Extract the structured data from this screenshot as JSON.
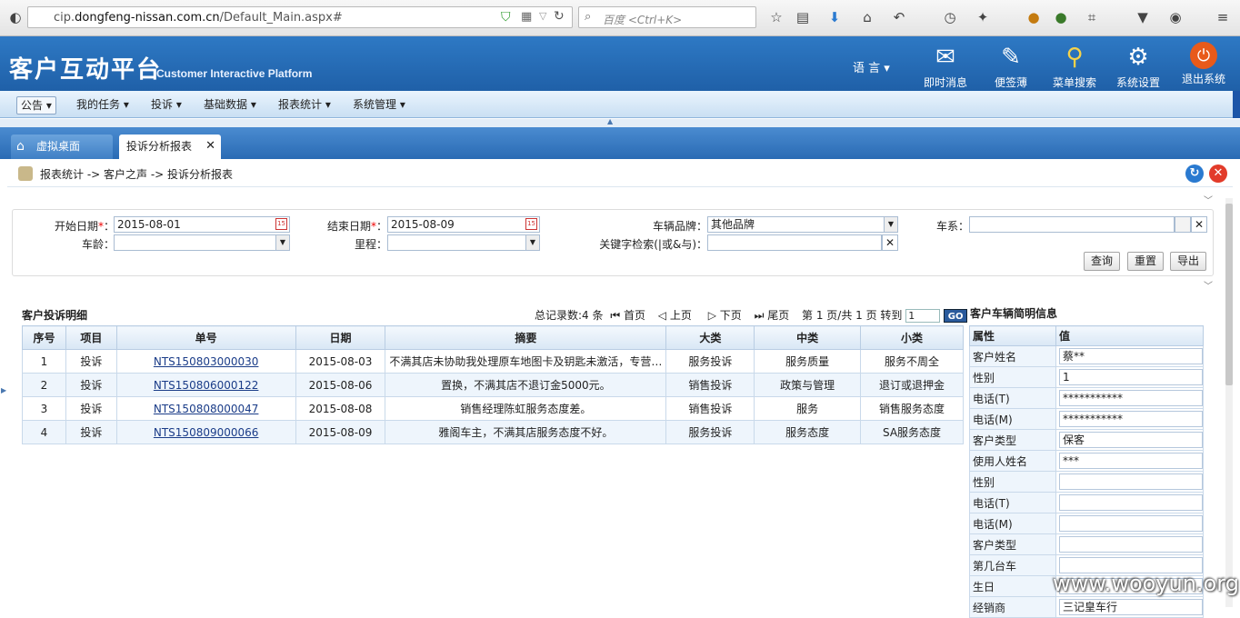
{
  "browser": {
    "url_prefix": "cip.",
    "url_domain": "dongfeng-nissan.com.cn",
    "url_path": "/Default_Main.aspx#",
    "search_placeholder": "百度 <Ctrl+K>"
  },
  "header": {
    "title": "客户互动平台",
    "subtitle": "Customer Interactive Platform",
    "language": "语 言",
    "tools": [
      "即时消息",
      "便签薄",
      "菜单搜索",
      "系统设置",
      "退出系统"
    ]
  },
  "menu": [
    "公告",
    "我的任务",
    "投诉",
    "基础数据",
    "报表统计",
    "系统管理"
  ],
  "tabs": [
    "虚拟桌面",
    "投诉分析报表"
  ],
  "breadcrumb": "报表统计 -> 客户之声 -> 投诉分析报表",
  "filter": {
    "start_label": "开始日期",
    "start_value": "2015-08-01",
    "end_label": "结束日期",
    "end_value": "2015-08-09",
    "brand_label": "车辆品牌：",
    "brand_value": "其他品牌",
    "series_label": "车系：",
    "age_label": "车龄：",
    "mileage_label": "里程：",
    "keyword_label": "关键字检索(|或&与)：",
    "query": "查询",
    "reset": "重置",
    "export": "导出"
  },
  "complaints": {
    "title": "客户投诉明细",
    "pager": {
      "total": "总记录数:4 条",
      "first": "首页",
      "prev": "上页",
      "next": "下页",
      "last": "尾页",
      "page_info": "第 1 页/共 1 页 转到",
      "goto_value": "1",
      "go": "GO"
    },
    "columns": [
      "序号",
      "项目",
      "单号",
      "日期",
      "摘要",
      "大类",
      "中类",
      "小类"
    ],
    "rows": [
      [
        "1",
        "投诉",
        "NTS150803000030",
        "2015-08-03",
        "不满其店未协助我处理原车地图卡及钥匙未激活，专营…",
        "服务投诉",
        "服务质量",
        "服务不周全"
      ],
      [
        "2",
        "投诉",
        "NTS150806000122",
        "2015-08-06",
        "置换，不满其店不退订金5000元。",
        "销售投诉",
        "政策与管理",
        "退订或退押金"
      ],
      [
        "3",
        "投诉",
        "NTS150808000047",
        "2015-08-08",
        "销售经理陈虹服务态度差。",
        "销售投诉",
        "服务",
        "销售服务态度"
      ],
      [
        "4",
        "投诉",
        "NTS150809000066",
        "2015-08-09",
        "雅阁车主，不满其店服务态度不好。",
        "服务投诉",
        "服务态度",
        "SA服务态度"
      ]
    ]
  },
  "vehicle": {
    "title": "客户车辆简明信息",
    "columns": [
      "属性",
      "值"
    ],
    "rows": [
      [
        "客户姓名",
        "蔡**"
      ],
      [
        "性别",
        "1"
      ],
      [
        "电话(T)",
        "***********"
      ],
      [
        "电话(M)",
        "***********"
      ],
      [
        "客户类型",
        "保客"
      ],
      [
        "使用人姓名",
        "***"
      ],
      [
        "性别",
        ""
      ],
      [
        "电话(T)",
        ""
      ],
      [
        "电话(M)",
        ""
      ],
      [
        "客户类型",
        ""
      ],
      [
        "第几台车",
        ""
      ],
      [
        "生日",
        ""
      ],
      [
        "经销商",
        "三记皇车行"
      ]
    ]
  },
  "watermark": "www.wooyun.org"
}
